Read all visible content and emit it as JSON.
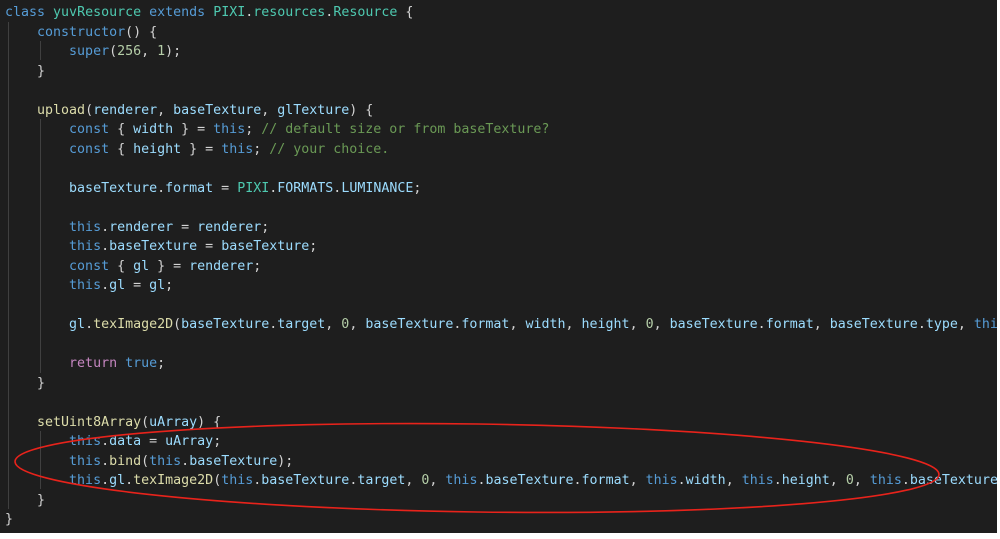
{
  "theme": {
    "background": "#1e1e1e",
    "annotation_color": "#e8231b"
  },
  "code": {
    "lines": [
      [
        [
          "k",
          "class"
        ],
        [
          "p",
          " "
        ],
        [
          "c",
          "yuvResource"
        ],
        [
          "p",
          " "
        ],
        [
          "k",
          "extends"
        ],
        [
          "p",
          " "
        ],
        [
          "c",
          "PIXI"
        ],
        [
          "p",
          "."
        ],
        [
          "c",
          "resources"
        ],
        [
          "p",
          "."
        ],
        [
          "c",
          "Resource"
        ],
        [
          "p",
          " {"
        ]
      ],
      [
        [
          "p",
          "    "
        ],
        [
          "k",
          "constructor"
        ],
        [
          "p",
          "() {"
        ]
      ],
      [
        [
          "p",
          "        "
        ],
        [
          "k",
          "super"
        ],
        [
          "p",
          "("
        ],
        [
          "n",
          "256"
        ],
        [
          "p",
          ", "
        ],
        [
          "n",
          "1"
        ],
        [
          "p",
          ");"
        ]
      ],
      [
        [
          "p",
          "    }"
        ]
      ],
      [],
      [
        [
          "p",
          "    "
        ],
        [
          "f",
          "upload"
        ],
        [
          "p",
          "("
        ],
        [
          "v",
          "renderer"
        ],
        [
          "p",
          ", "
        ],
        [
          "v",
          "baseTexture"
        ],
        [
          "p",
          ", "
        ],
        [
          "v",
          "glTexture"
        ],
        [
          "p",
          ") {"
        ]
      ],
      [
        [
          "p",
          "        "
        ],
        [
          "k",
          "const"
        ],
        [
          "p",
          " { "
        ],
        [
          "v",
          "width"
        ],
        [
          "p",
          " } = "
        ],
        [
          "k",
          "this"
        ],
        [
          "p",
          "; "
        ],
        [
          "m",
          "// default size or from baseTexture?"
        ]
      ],
      [
        [
          "p",
          "        "
        ],
        [
          "k",
          "const"
        ],
        [
          "p",
          " { "
        ],
        [
          "v",
          "height"
        ],
        [
          "p",
          " } = "
        ],
        [
          "k",
          "this"
        ],
        [
          "p",
          "; "
        ],
        [
          "m",
          "// your choice."
        ]
      ],
      [],
      [
        [
          "p",
          "        "
        ],
        [
          "v",
          "baseTexture"
        ],
        [
          "p",
          "."
        ],
        [
          "v",
          "format"
        ],
        [
          "p",
          " = "
        ],
        [
          "c",
          "PIXI"
        ],
        [
          "p",
          "."
        ],
        [
          "v",
          "FORMATS"
        ],
        [
          "p",
          "."
        ],
        [
          "v",
          "LUMINANCE"
        ],
        [
          "p",
          ";"
        ]
      ],
      [],
      [
        [
          "p",
          "        "
        ],
        [
          "k",
          "this"
        ],
        [
          "p",
          "."
        ],
        [
          "v",
          "renderer"
        ],
        [
          "p",
          " = "
        ],
        [
          "v",
          "renderer"
        ],
        [
          "p",
          ";"
        ]
      ],
      [
        [
          "p",
          "        "
        ],
        [
          "k",
          "this"
        ],
        [
          "p",
          "."
        ],
        [
          "v",
          "baseTexture"
        ],
        [
          "p",
          " = "
        ],
        [
          "v",
          "baseTexture"
        ],
        [
          "p",
          ";"
        ]
      ],
      [
        [
          "p",
          "        "
        ],
        [
          "k",
          "const"
        ],
        [
          "p",
          " { "
        ],
        [
          "v",
          "gl"
        ],
        [
          "p",
          " } = "
        ],
        [
          "v",
          "renderer"
        ],
        [
          "p",
          ";"
        ]
      ],
      [
        [
          "p",
          "        "
        ],
        [
          "k",
          "this"
        ],
        [
          "p",
          "."
        ],
        [
          "v",
          "gl"
        ],
        [
          "p",
          " = "
        ],
        [
          "v",
          "gl"
        ],
        [
          "p",
          ";"
        ]
      ],
      [],
      [
        [
          "p",
          "        "
        ],
        [
          "v",
          "gl"
        ],
        [
          "p",
          "."
        ],
        [
          "f",
          "texImage2D"
        ],
        [
          "p",
          "("
        ],
        [
          "v",
          "baseTexture"
        ],
        [
          "p",
          "."
        ],
        [
          "v",
          "target"
        ],
        [
          "p",
          ", "
        ],
        [
          "n",
          "0"
        ],
        [
          "p",
          ", "
        ],
        [
          "v",
          "baseTexture"
        ],
        [
          "p",
          "."
        ],
        [
          "v",
          "format"
        ],
        [
          "p",
          ", "
        ],
        [
          "v",
          "width"
        ],
        [
          "p",
          ", "
        ],
        [
          "v",
          "height"
        ],
        [
          "p",
          ", "
        ],
        [
          "n",
          "0"
        ],
        [
          "p",
          ", "
        ],
        [
          "v",
          "baseTexture"
        ],
        [
          "p",
          "."
        ],
        [
          "v",
          "format"
        ],
        [
          "p",
          ", "
        ],
        [
          "v",
          "baseTexture"
        ],
        [
          "p",
          "."
        ],
        [
          "v",
          "type"
        ],
        [
          "p",
          ", "
        ],
        [
          "k",
          "thi"
        ]
      ],
      [],
      [
        [
          "p",
          "        "
        ],
        [
          "r",
          "return"
        ],
        [
          "p",
          " "
        ],
        [
          "k",
          "true"
        ],
        [
          "p",
          ";"
        ]
      ],
      [
        [
          "p",
          "    }"
        ]
      ],
      [],
      [
        [
          "p",
          "    "
        ],
        [
          "f",
          "setUint8Array"
        ],
        [
          "p",
          "("
        ],
        [
          "v",
          "uArray"
        ],
        [
          "p",
          ") {"
        ]
      ],
      [
        [
          "p",
          "        "
        ],
        [
          "k",
          "this"
        ],
        [
          "p",
          "."
        ],
        [
          "v",
          "data"
        ],
        [
          "p",
          " = "
        ],
        [
          "v",
          "uArray"
        ],
        [
          "p",
          ";"
        ]
      ],
      [
        [
          "p",
          "        "
        ],
        [
          "k",
          "this"
        ],
        [
          "p",
          "."
        ],
        [
          "f",
          "bind"
        ],
        [
          "p",
          "("
        ],
        [
          "k",
          "this"
        ],
        [
          "p",
          "."
        ],
        [
          "v",
          "baseTexture"
        ],
        [
          "p",
          ");"
        ]
      ],
      [
        [
          "p",
          "        "
        ],
        [
          "k",
          "this"
        ],
        [
          "p",
          "."
        ],
        [
          "v",
          "gl"
        ],
        [
          "p",
          "."
        ],
        [
          "f",
          "texImage2D"
        ],
        [
          "p",
          "("
        ],
        [
          "k",
          "this"
        ],
        [
          "p",
          "."
        ],
        [
          "v",
          "baseTexture"
        ],
        [
          "p",
          "."
        ],
        [
          "v",
          "target"
        ],
        [
          "p",
          ", "
        ],
        [
          "n",
          "0"
        ],
        [
          "p",
          ", "
        ],
        [
          "k",
          "this"
        ],
        [
          "p",
          "."
        ],
        [
          "v",
          "baseTexture"
        ],
        [
          "p",
          "."
        ],
        [
          "v",
          "format"
        ],
        [
          "p",
          ", "
        ],
        [
          "k",
          "this"
        ],
        [
          "p",
          "."
        ],
        [
          "v",
          "width"
        ],
        [
          "p",
          ", "
        ],
        [
          "k",
          "this"
        ],
        [
          "p",
          "."
        ],
        [
          "v",
          "height"
        ],
        [
          "p",
          ", "
        ],
        [
          "n",
          "0"
        ],
        [
          "p",
          ", "
        ],
        [
          "k",
          "this"
        ],
        [
          "p",
          "."
        ],
        [
          "v",
          "baseTexture"
        ]
      ],
      [
        [
          "p",
          "    }"
        ]
      ],
      [
        [
          "p",
          "}"
        ]
      ]
    ]
  }
}
